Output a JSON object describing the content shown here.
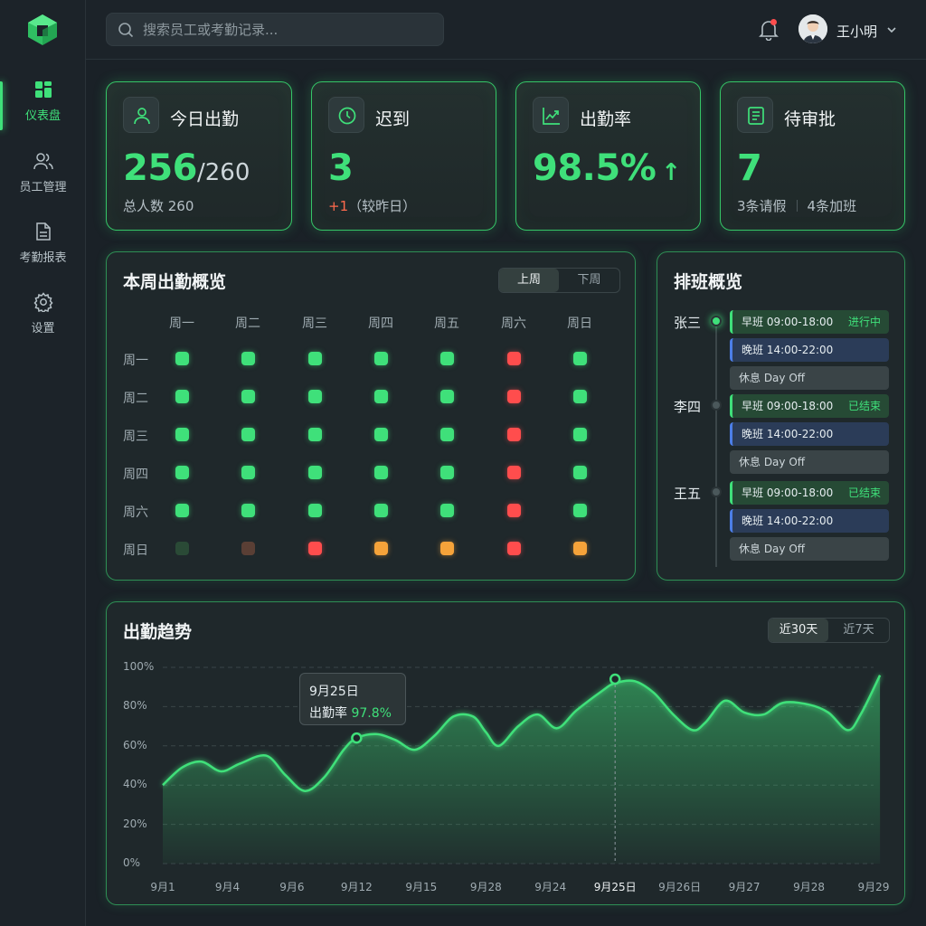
{
  "colors": {
    "accent": "#3fe07a",
    "late": "#ff4d4d",
    "warn": "#f5a33a",
    "evening": "#4c7ee8"
  },
  "sidebar": {
    "logo": "app-logo",
    "items": [
      {
        "label": "仪表盘",
        "icon": "dashboard-icon",
        "active": true
      },
      {
        "label": "员工管理",
        "icon": "users-icon"
      },
      {
        "label": "考勤报表",
        "icon": "report-icon"
      },
      {
        "label": "设置",
        "icon": "gear-icon"
      }
    ]
  },
  "topbar": {
    "search_placeholder": "搜索员工或考勤记录...",
    "user_name": "王小明"
  },
  "stats": [
    {
      "title": "今日出勤",
      "icon": "user-icon",
      "value": "256",
      "suffix": "/260",
      "sub": "总人数 260"
    },
    {
      "title": "迟到",
      "icon": "clock-icon",
      "value": "3",
      "sub_delta": "+1",
      "sub": "（较昨日）"
    },
    {
      "title": "出勤率",
      "icon": "trend-icon",
      "value": "98.5%",
      "arrow": "↑"
    },
    {
      "title": "待审批",
      "icon": "document-icon",
      "value": "7",
      "sub_a": "3条请假",
      "sub_b": "4条加班"
    }
  ],
  "weekly": {
    "title": "本周出勤概览",
    "toggle": {
      "left": "上周",
      "right": "下周",
      "active": "left"
    },
    "columns": [
      "周一",
      "周二",
      "周三",
      "周四",
      "周五",
      "周六",
      "周日"
    ],
    "rows": [
      {
        "label": "周一",
        "cells": [
          "g",
          "g",
          "g",
          "g",
          "g",
          "r",
          "g"
        ]
      },
      {
        "label": "周二",
        "cells": [
          "g",
          "g",
          "g",
          "g",
          "g",
          "r",
          "g"
        ]
      },
      {
        "label": "周三",
        "cells": [
          "g",
          "g",
          "g",
          "g",
          "g",
          "r",
          "g"
        ]
      },
      {
        "label": "周四",
        "cells": [
          "g",
          "g",
          "g",
          "g",
          "g",
          "r",
          "g"
        ]
      },
      {
        "label": "周六",
        "cells": [
          "g",
          "g",
          "g",
          "g",
          "g",
          "r",
          "g"
        ]
      },
      {
        "label": "周日",
        "cells": [
          "dg",
          "db",
          "r",
          "o",
          "o",
          "r",
          "o"
        ]
      }
    ]
  },
  "schedule": {
    "title": "排班概览",
    "people": [
      {
        "name": "张三",
        "active": true,
        "shifts": [
          {
            "type": "morning",
            "text": "早班 09:00-18:00",
            "tag": "进行中"
          },
          {
            "type": "evening",
            "text": "晚班 14:00-22:00"
          },
          {
            "type": "off",
            "text": "休息 Day Off"
          }
        ]
      },
      {
        "name": "李四",
        "active": false,
        "shifts": [
          {
            "type": "morning",
            "text": "早班 09:00-18:00",
            "tag": "已结束"
          },
          {
            "type": "evening",
            "text": "晚班 14:00-22:00"
          },
          {
            "type": "off",
            "text": "休息 Day Off"
          }
        ]
      },
      {
        "name": "王五",
        "active": false,
        "shifts": [
          {
            "type": "morning",
            "text": "早班 09:00-18:00",
            "tag": "已结束"
          },
          {
            "type": "evening",
            "text": "晚班 14:00-22:00"
          },
          {
            "type": "off",
            "text": "休息 Day Off"
          }
        ]
      }
    ]
  },
  "trend": {
    "title": "出勤趋势",
    "toggle": {
      "left": "近30天",
      "right": "近7天",
      "active": "left"
    },
    "tooltip": {
      "date": "9月25日",
      "label": "出勤率",
      "value": "97.8%"
    }
  },
  "chart_data": {
    "type": "area",
    "title": "出勤趋势",
    "xlabel": "",
    "ylabel": "",
    "ylim": [
      0,
      100
    ],
    "yticks": [
      "0%",
      "20%",
      "40%",
      "60%",
      "80%",
      "100%"
    ],
    "grid": true,
    "x_ticks": [
      "9月1",
      "9月4",
      "9月6",
      "9月12",
      "9月15",
      "9月28",
      "9月24",
      "9月25日",
      "9月26日",
      "9月27",
      "9月28",
      "9月29"
    ],
    "highlight_tick": "9月25日",
    "series": [
      {
        "x": [
          0,
          0.3,
          0.6,
          0.9,
          1.2,
          1.6,
          1.9,
          2.2,
          2.5,
          2.8,
          3.0,
          3.3,
          3.6,
          3.9,
          4.2,
          4.5,
          4.8,
          5.0,
          5.2,
          5.5,
          5.8,
          6.1,
          6.4,
          6.8,
          7.0,
          7.3,
          7.6,
          7.9,
          8.2,
          8.4,
          8.7,
          9.0,
          9.3,
          9.6,
          10.0,
          10.3,
          10.6,
          10.8,
          11.1
        ],
        "values": [
          40,
          49,
          52,
          47,
          51,
          55,
          45,
          37,
          44,
          58,
          64,
          66,
          63,
          58,
          65,
          75,
          75,
          67,
          60,
          70,
          76,
          69,
          78,
          88,
          92,
          93,
          87,
          76,
          68,
          72,
          83,
          77,
          76,
          82,
          81,
          77,
          68,
          76,
          96
        ]
      }
    ],
    "markers": [
      {
        "x": 3.0,
        "y": 64
      },
      {
        "x": 7.0,
        "y": 94
      }
    ]
  }
}
